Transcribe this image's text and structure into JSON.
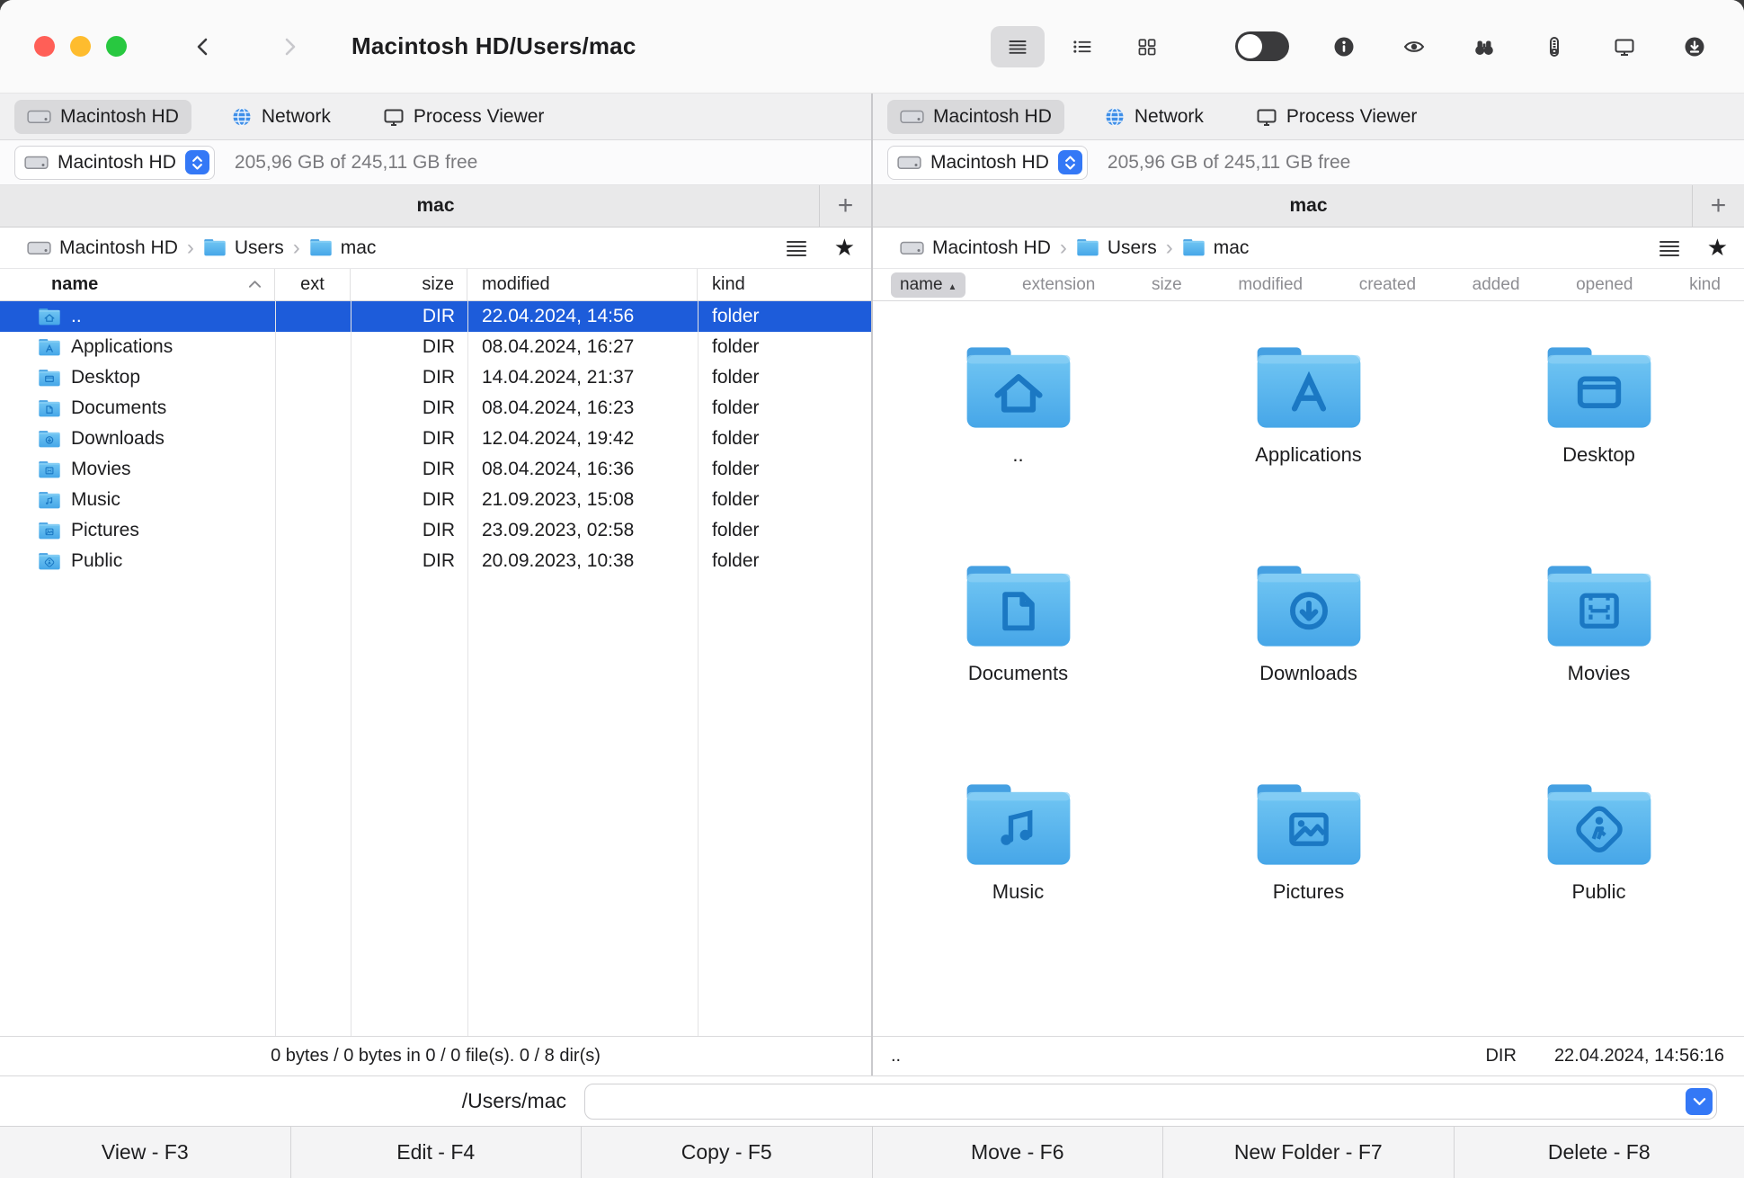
{
  "window": {
    "title": "Macintosh HD/Users/mac"
  },
  "pane_header": {
    "tabs": [
      {
        "label": "Macintosh HD",
        "icon": "hard-drive-icon"
      },
      {
        "label": "Network",
        "icon": "globe-icon"
      },
      {
        "label": "Process Viewer",
        "icon": "monitor-icon"
      }
    ],
    "volume": {
      "name": "Macintosh HD",
      "free": "205,96 GB of 245,11 GB free"
    },
    "folder_tab": "mac",
    "new_tab_label": "+",
    "breadcrumb": [
      {
        "label": "Macintosh HD",
        "icon": "hard-drive-icon"
      },
      {
        "label": "Users",
        "icon": "folder-icon"
      },
      {
        "label": "mac",
        "icon": "folder-icon"
      }
    ]
  },
  "left_pane": {
    "columns": [
      "name",
      "ext",
      "size",
      "modified",
      "kind"
    ],
    "rows": [
      {
        "name": "..",
        "ext": "",
        "size": "DIR",
        "modified": "22.04.2024, 14:56",
        "kind": "folder",
        "icon": "home-folder-icon",
        "selected": true
      },
      {
        "name": "Applications",
        "ext": "",
        "size": "DIR",
        "modified": "08.04.2024, 16:27",
        "kind": "folder",
        "icon": "applications-folder-icon",
        "selected": false
      },
      {
        "name": "Desktop",
        "ext": "",
        "size": "DIR",
        "modified": "14.04.2024, 21:37",
        "kind": "folder",
        "icon": "desktop-folder-icon",
        "selected": false
      },
      {
        "name": "Documents",
        "ext": "",
        "size": "DIR",
        "modified": "08.04.2024, 16:23",
        "kind": "folder",
        "icon": "documents-folder-icon",
        "selected": false
      },
      {
        "name": "Downloads",
        "ext": "",
        "size": "DIR",
        "modified": "12.04.2024, 19:42",
        "kind": "folder",
        "icon": "downloads-folder-icon",
        "selected": false
      },
      {
        "name": "Movies",
        "ext": "",
        "size": "DIR",
        "modified": "08.04.2024, 16:36",
        "kind": "folder",
        "icon": "movies-folder-icon",
        "selected": false
      },
      {
        "name": "Music",
        "ext": "",
        "size": "DIR",
        "modified": "21.09.2023, 15:08",
        "kind": "folder",
        "icon": "music-folder-icon",
        "selected": false
      },
      {
        "name": "Pictures",
        "ext": "",
        "size": "DIR",
        "modified": "23.09.2023, 02:58",
        "kind": "folder",
        "icon": "pictures-folder-icon",
        "selected": false
      },
      {
        "name": "Public",
        "ext": "",
        "size": "DIR",
        "modified": "20.09.2023, 10:38",
        "kind": "folder",
        "icon": "public-folder-icon",
        "selected": false
      }
    ],
    "status": "0 bytes / 0 bytes in 0 / 0 file(s). 0 / 8 dir(s)"
  },
  "right_pane": {
    "columns": [
      "name",
      "extension",
      "size",
      "modified",
      "created",
      "added",
      "opened",
      "kind"
    ],
    "sort_column": "name",
    "items": [
      {
        "label": "..",
        "icon": "home-folder-icon"
      },
      {
        "label": "Applications",
        "icon": "applications-folder-icon"
      },
      {
        "label": "Desktop",
        "icon": "desktop-folder-icon"
      },
      {
        "label": "Documents",
        "icon": "documents-folder-icon"
      },
      {
        "label": "Downloads",
        "icon": "downloads-folder-icon"
      },
      {
        "label": "Movies",
        "icon": "movies-folder-icon"
      },
      {
        "label": "Music",
        "icon": "music-folder-icon"
      },
      {
        "label": "Pictures",
        "icon": "pictures-folder-icon"
      },
      {
        "label": "Public",
        "icon": "public-folder-icon"
      }
    ],
    "status": {
      "name": "..",
      "size": "DIR",
      "modified": "22.04.2024, 14:56:16"
    }
  },
  "command_line": {
    "path": "/Users/mac",
    "value": ""
  },
  "function_bar": [
    "View - F3",
    "Edit - F4",
    "Copy - F5",
    "Move - F6",
    "New Folder - F7",
    "Delete - F8"
  ]
}
